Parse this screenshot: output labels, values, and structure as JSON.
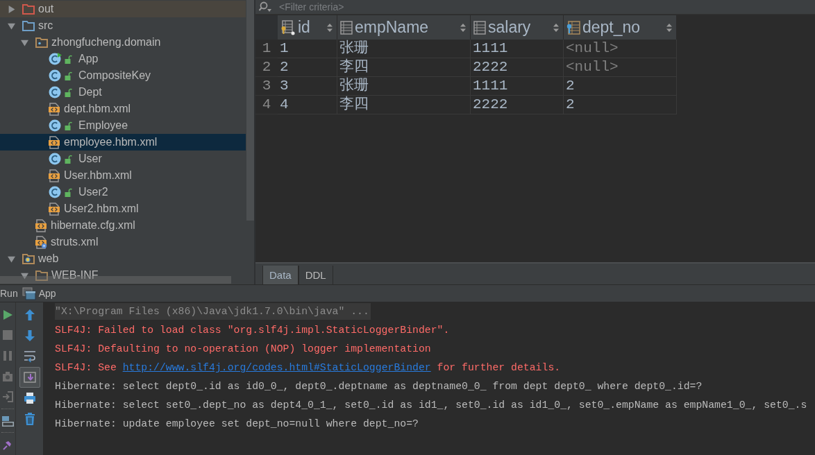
{
  "project_tree": {
    "items": [
      {
        "label": "out",
        "kind": "excluded-folder",
        "expanded": false,
        "selected": false
      },
      {
        "label": "src",
        "kind": "source-folder",
        "expanded": true,
        "selected": false,
        "children": [
          {
            "label": "zhongfucheng.domain",
            "kind": "package",
            "expanded": true,
            "selected": false,
            "children": [
              {
                "label": "App",
                "kind": "main-class",
                "selected": false
              },
              {
                "label": "CompositeKey",
                "kind": "class",
                "selected": false
              },
              {
                "label": "Dept",
                "kind": "class",
                "selected": false
              },
              {
                "label": "dept.hbm.xml",
                "kind": "xml",
                "selected": false
              },
              {
                "label": "Employee",
                "kind": "class",
                "selected": false
              },
              {
                "label": "employee.hbm.xml",
                "kind": "xml",
                "selected": true
              },
              {
                "label": "User",
                "kind": "class",
                "selected": false
              },
              {
                "label": "User.hbm.xml",
                "kind": "xml",
                "selected": false
              },
              {
                "label": "User2",
                "kind": "class",
                "selected": false
              },
              {
                "label": "User2.hbm.xml",
                "kind": "xml",
                "selected": false
              }
            ]
          },
          {
            "label": "hibernate.cfg.xml",
            "kind": "xml",
            "selected": false
          },
          {
            "label": "struts.xml",
            "kind": "struts-xml",
            "selected": false
          }
        ]
      },
      {
        "label": "web",
        "kind": "web-folder",
        "expanded": true,
        "selected": false,
        "children": [
          {
            "label": "WEB-INF",
            "kind": "folder",
            "expanded": true,
            "selected": false
          }
        ]
      }
    ]
  },
  "filter_bar": {
    "placeholder": "<Filter criteria>"
  },
  "table": {
    "columns": [
      {
        "name": "id",
        "kind": "primary-key"
      },
      {
        "name": "empName",
        "kind": "column"
      },
      {
        "name": "salary",
        "kind": "column"
      },
      {
        "name": "dept_no",
        "kind": "foreign-key"
      }
    ],
    "rows": [
      {
        "number": "1",
        "cells": [
          {
            "text": "1",
            "is_null": false
          },
          {
            "text": "张珊",
            "is_null": false
          },
          {
            "text": "1111",
            "is_null": false
          },
          {
            "text": "<null>",
            "is_null": true
          }
        ]
      },
      {
        "number": "2",
        "cells": [
          {
            "text": "2",
            "is_null": false
          },
          {
            "text": "李四",
            "is_null": false
          },
          {
            "text": "2222",
            "is_null": false
          },
          {
            "text": "<null>",
            "is_null": true
          }
        ]
      },
      {
        "number": "3",
        "cells": [
          {
            "text": "3",
            "is_null": false
          },
          {
            "text": "张珊",
            "is_null": false
          },
          {
            "text": "1111",
            "is_null": false
          },
          {
            "text": "2",
            "is_null": false
          }
        ]
      },
      {
        "number": "4",
        "cells": [
          {
            "text": "4",
            "is_null": false
          },
          {
            "text": "李四",
            "is_null": false
          },
          {
            "text": "2222",
            "is_null": false
          },
          {
            "text": "2",
            "is_null": false
          }
        ]
      }
    ]
  },
  "result_tabs": [
    {
      "label": "Data",
      "selected": true
    },
    {
      "label": "DDL",
      "selected": false
    }
  ],
  "run_panel": {
    "title": "Run",
    "config": "App",
    "actions": [
      {
        "disabled": false
      },
      {
        "disabled": true
      },
      {
        "disabled": true
      },
      {
        "disabled": true
      },
      {
        "disabled": true
      },
      {
        "disabled": false
      },
      {
        "disabled": false
      }
    ],
    "console_tools": [
      {
        "on": false
      },
      {
        "on": false
      },
      {
        "on": false
      },
      {
        "on": true
      },
      {
        "on": false
      },
      {
        "on": false
      }
    ],
    "lines": [
      {
        "kind": "command",
        "text": "\"X:\\Program Files (x86)\\Java\\jdk1.7.0\\bin\\java\" ..."
      },
      {
        "kind": "error",
        "text": "SLF4J: Failed to load class \"org.slf4j.impl.StaticLoggerBinder\"."
      },
      {
        "kind": "error",
        "text": "SLF4J: Defaulting to no-operation (NOP) logger implementation"
      },
      {
        "kind": "error",
        "text": "SLF4J: See ",
        "link": "http://www.slf4j.org/codes.html#StaticLoggerBinder",
        "after": " for further details."
      },
      {
        "kind": "info",
        "text": "Hibernate: select dept0_.id as id0_0_, dept0_.deptname as deptname0_0_ from dept dept0_ where dept0_.id=?"
      },
      {
        "kind": "info",
        "text": "Hibernate: select set0_.dept_no as dept4_0_1_, set0_.id as id1_, set0_.id as id1_0_, set0_.empName as empName1_0_, set0_.s"
      },
      {
        "kind": "info",
        "text": "Hibernate: update employee set dept_no=null where dept_no=?"
      }
    ]
  }
}
